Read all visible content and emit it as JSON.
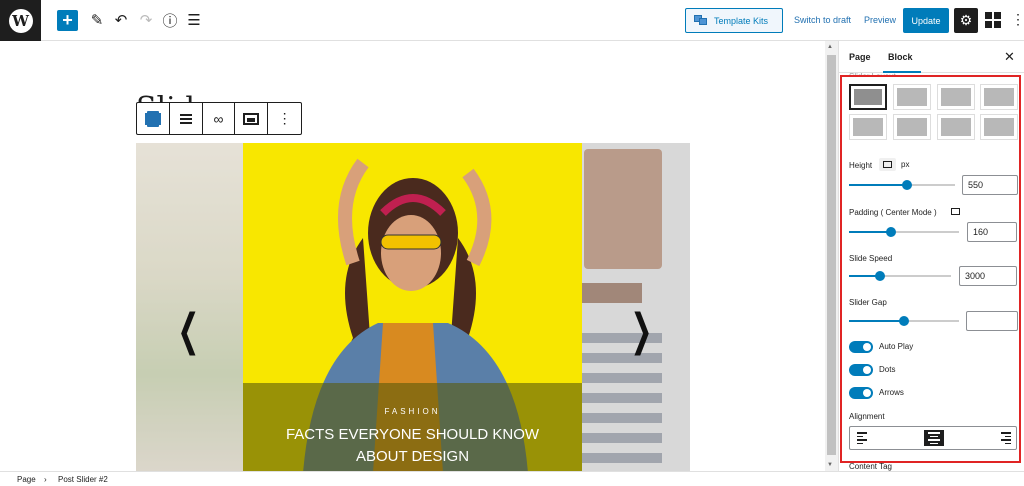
{
  "topbar": {
    "logo": "W",
    "add": "+",
    "tools_icon": "✎",
    "undo_icon": "↶",
    "redo_icon": "↷",
    "info_icon": "ⓘ",
    "list_icon": "☰",
    "template_kits": "Template Kits",
    "switch_to_draft": "Switch to draft",
    "preview": "Preview",
    "update": "Update",
    "settings_icon": "⚙",
    "more_icon": "⋮"
  },
  "canvas": {
    "page_title": "Slid",
    "toolbar": {
      "link_icon": "∞",
      "more_icon": "⋮"
    },
    "slider": {
      "prev_arrow": "❮",
      "next_arrow": "❯",
      "category": "FASHION",
      "title": "FACTS EVERYONE SHOULD KNOW ABOUT DESIGN"
    }
  },
  "sidebar": {
    "tab_page": "Page",
    "tab_block": "Block",
    "close": "✕",
    "cut_label": "Slider Layout",
    "height_label": "Height",
    "height_unit": "px",
    "height_value": "550",
    "height_fraction": 0.55,
    "padding_label": "Padding ( Center Mode )",
    "padding_value": "160",
    "padding_fraction": 0.38,
    "speed_label": "Slide Speed",
    "speed_value": "3000",
    "speed_fraction": 0.3,
    "gap_label": "Slider Gap",
    "gap_value": "",
    "gap_fraction": 0.5,
    "autoplay_label": "Auto Play",
    "dots_label": "Dots",
    "arrows_label": "Arrows",
    "alignment_label": "Alignment",
    "content_tag_label": "Content Tag"
  },
  "footer": {
    "crumb_page": "Page",
    "separator": "›",
    "crumb_block": "Post Slider #2"
  },
  "colors": {
    "accent": "#007cba",
    "highlight": "#e02424",
    "slide_yellow": "#f8e700"
  },
  "icons": [
    "wordpress-icon",
    "plus-icon",
    "pencil-icon",
    "undo-icon",
    "redo-icon",
    "info-icon",
    "list-view-icon",
    "gear-icon",
    "blocks-icon",
    "more-vertical-icon",
    "close-icon",
    "desktop-icon",
    "link-icon",
    "image-icon",
    "chevron-left-icon",
    "chevron-right-icon"
  ]
}
